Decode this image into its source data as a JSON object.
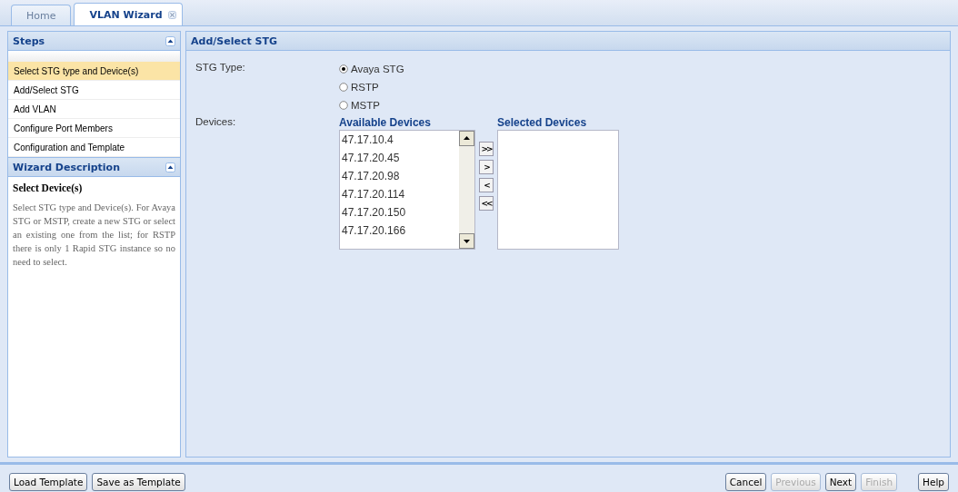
{
  "tabs": [
    {
      "label": "Home",
      "selected": false,
      "closable": false
    },
    {
      "label": "VLAN Wizard",
      "selected": true,
      "closable": true
    }
  ],
  "steps": {
    "title": "Steps",
    "items": [
      {
        "label": "Select STG type and Device(s)",
        "selected": true
      },
      {
        "label": "Add/Select STG",
        "selected": false
      },
      {
        "label": "Add VLAN",
        "selected": false
      },
      {
        "label": "Configure Port Members",
        "selected": false
      },
      {
        "label": "Configuration and Template",
        "selected": false
      }
    ]
  },
  "description": {
    "title": "Wizard Description",
    "heading": "Select Device(s)",
    "text": "Select STG type and Device(s). For Avaya STG or MSTP, create a new STG or select an existing one from the list; for RSTP there is only 1 Rapid STG instance so no need to select."
  },
  "main": {
    "title": "Add/Select STG",
    "stg_type_label": "STG Type:",
    "stg_types": [
      {
        "label": "Avaya STG",
        "selected": true
      },
      {
        "label": "RSTP",
        "selected": false
      },
      {
        "label": "MSTP",
        "selected": false
      }
    ],
    "devices_label": "Devices:",
    "available": {
      "title": "Available Devices",
      "items": [
        "47.17.10.4",
        "47.17.20.45",
        "47.17.20.98",
        "47.17.20.114",
        "47.17.20.150",
        "47.17.20.166"
      ]
    },
    "move_buttons": [
      ">>",
      ">",
      "<",
      "<<"
    ],
    "selected": {
      "title": "Selected Devices"
    }
  },
  "footer": {
    "left_buttons": [
      {
        "label": "Load Template",
        "disabled": false
      },
      {
        "label": "Save as Template",
        "disabled": false
      }
    ],
    "right_buttons": [
      {
        "label": "Cancel",
        "disabled": false
      },
      {
        "label": "Previous",
        "disabled": true
      },
      {
        "label": "Next",
        "disabled": false
      },
      {
        "label": "Finish",
        "disabled": true
      }
    ],
    "help_button": {
      "label": "Help",
      "disabled": false
    }
  }
}
